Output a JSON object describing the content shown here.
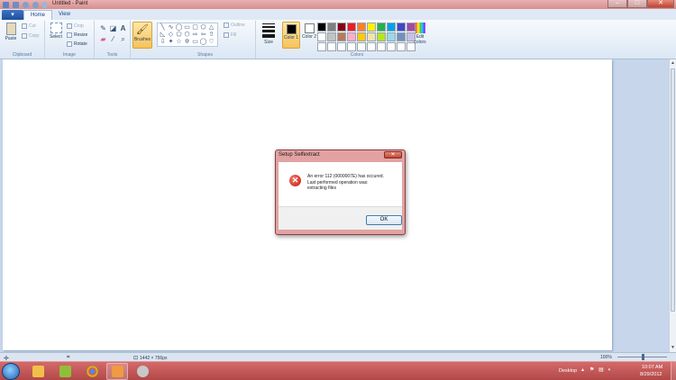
{
  "window": {
    "title": "Untitled - Paint",
    "minimize_label": "–",
    "maximize_label": "□",
    "close_label": "✕"
  },
  "ribbon_tabs": {
    "menu_label": "▾",
    "home": "Home",
    "view": "View"
  },
  "clipboard": {
    "paste": "Paste",
    "cut": "Cut",
    "copy": "Copy",
    "label": "Clipboard"
  },
  "image": {
    "select": "Select",
    "crop": "Crop",
    "resize": "Resize",
    "rotate": "Rotate",
    "label": "Image"
  },
  "tools": {
    "label": "Tools",
    "brushes": "Brushes"
  },
  "shapes": {
    "outline": "Outline",
    "fill": "Fill",
    "label": "Shapes"
  },
  "size": {
    "label": "Size"
  },
  "colors": {
    "color1_label": "Color 1",
    "color2_label": "Color 2",
    "color1_value": "#000000",
    "color2_value": "#ffffff",
    "edit_colors": "Edit colors",
    "label": "Colors",
    "palette": [
      "#000000",
      "#7f7f7f",
      "#880015",
      "#ed1c24",
      "#ff7f27",
      "#fff200",
      "#22b14c",
      "#00a2e8",
      "#3f48cc",
      "#a349a4",
      "#ffffff",
      "#c3c3c3",
      "#b97a57",
      "#ffaec9",
      "#ffc90e",
      "#efe4b0",
      "#b5e61d",
      "#99d9ea",
      "#7092be",
      "#c8bfe7",
      "#ffffff",
      "#ffffff",
      "#ffffff",
      "#ffffff",
      "#ffffff",
      "#ffffff",
      "#ffffff",
      "#ffffff",
      "#ffffff",
      "#ffffff"
    ]
  },
  "dialog": {
    "title": "Setup Selfextract",
    "close": "✕",
    "message_line1": "An error 112 (0000007E) has occured.",
    "message_line2": "Last performed operation was:",
    "message_line3": "extracting files",
    "ok": "OK"
  },
  "statusbar": {
    "dimensions": "1442 × 756px",
    "zoom": "100%"
  },
  "taskbar": {
    "desktop": "Desktop",
    "time": "10:07 AM",
    "date": "8/29/2012"
  }
}
